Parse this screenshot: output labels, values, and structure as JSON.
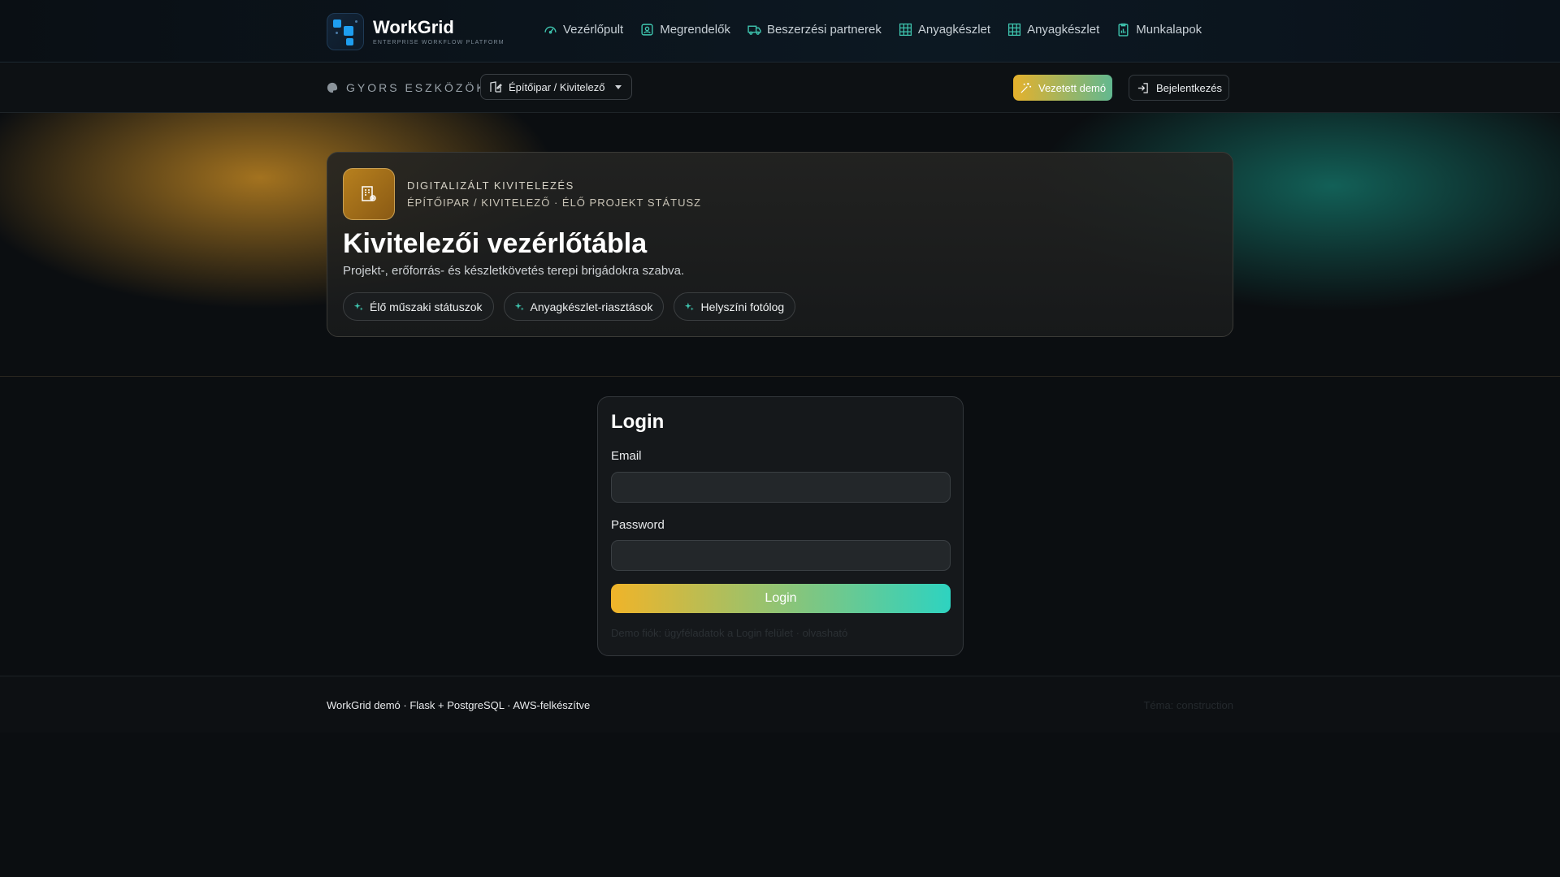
{
  "brand": {
    "name": "WorkGrid",
    "tagline": "ENTERPRISE WORKFLOW PLATFORM"
  },
  "nav": {
    "items": [
      {
        "label": "Vezérlőpult",
        "icon": "speedometer-icon"
      },
      {
        "label": "Megrendelők",
        "icon": "person-badge-icon"
      },
      {
        "label": "Beszerzési partnerek",
        "icon": "truck-icon"
      },
      {
        "label": "Anyagkészlet",
        "icon": "grid-icon"
      },
      {
        "label": "Anyagkészlet",
        "icon": "grid-icon"
      },
      {
        "label": "Munkalapok",
        "icon": "clipboard-chart-icon"
      }
    ]
  },
  "toolbar": {
    "quick_label": "GYORS ESZKÖZÖK",
    "sector_value": "Építőipar / Kivitelező",
    "demo_label": "Vezetett demó",
    "login_label": "Bejelentkezés"
  },
  "hero": {
    "eyebrow": "DIGITALIZÁLT KIVITELEZÉS",
    "subeyebrow": "ÉPÍTŐIPAR / KIVITELEZŐ · ÉLŐ PROJEKT STÁTUSZ",
    "title": "Kivitelezői vezérlőtábla",
    "description": "Projekt-, erőforrás- és készletkövetés terepi brigádokra szabva.",
    "chips": [
      {
        "label": "Élő műszaki státuszok"
      },
      {
        "label": "Anyagkészlet-riasztások"
      },
      {
        "label": "Helyszíni fotólog"
      }
    ]
  },
  "login": {
    "title": "Login",
    "email_label": "Email",
    "email_value": "",
    "password_label": "Password",
    "password_value": "",
    "submit_label": "Login",
    "hint": "Demo fiók: ügyféladatok a Login felület · olvasható"
  },
  "footer": {
    "left": "WorkGrid demó · Flask + PostgreSQL · AWS-felkészítve",
    "right": "Téma: construction"
  },
  "colors": {
    "accent_gold": "#f0b429",
    "accent_teal": "#2ed3c0",
    "nav_icon": "#3fc6b0",
    "background": "#0b0e11"
  }
}
